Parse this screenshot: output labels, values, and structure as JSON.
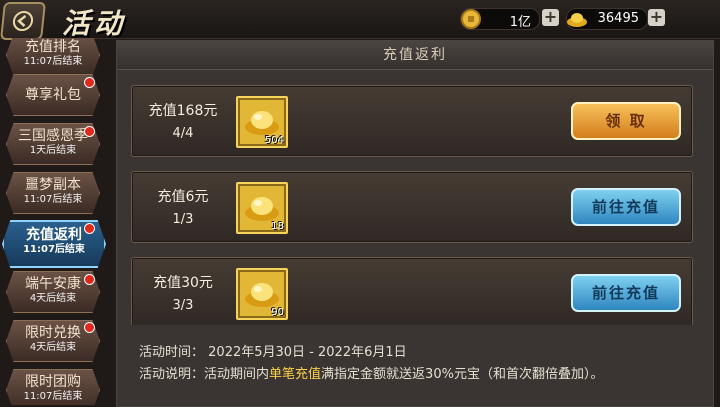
{
  "header": {
    "title": "活动"
  },
  "resources": {
    "copper": "1亿",
    "gold": "36495"
  },
  "sidebar": {
    "items": [
      {
        "name": "充值排名",
        "time": "11:07后结束",
        "dot": false
      },
      {
        "name": "尊享礼包",
        "time": "",
        "dot": true
      },
      {
        "name": "三国感恩季",
        "time": "1天后结束",
        "dot": true
      },
      {
        "name": "噩梦副本",
        "time": "11:07后结束",
        "dot": false
      },
      {
        "name": "充值返利",
        "time": "11:07后结束",
        "dot": true,
        "active": true
      },
      {
        "name": "端午安康",
        "time": "4天后结束",
        "dot": true
      },
      {
        "name": "限时兑换",
        "time": "4天后结束",
        "dot": true
      },
      {
        "name": "限时团购",
        "time": "11:07后结束",
        "dot": false
      }
    ]
  },
  "panel": {
    "title": "充值返利",
    "rows": [
      {
        "title": "充值168元",
        "progress": "4/4",
        "qty": "504",
        "button": "领 取",
        "button_type": "claim"
      },
      {
        "title": "充值6元",
        "progress": "1/3",
        "qty": "18",
        "button": "前往充值",
        "button_type": "go"
      },
      {
        "title": "充值30元",
        "progress": "3/3",
        "qty": "90",
        "button": "前往充值",
        "button_type": "go"
      }
    ],
    "info": {
      "time_label": "活动时间：",
      "time_value": "2022年5月30日 - 2022年6月1日",
      "desc_label": "活动说明：",
      "desc_pre": "活动期间内",
      "desc_highlight": "单笔充值",
      "desc_post": "满指定金额就送返30%元宝（和首次翻倍叠加）。"
    }
  },
  "colors": {
    "accent_gold": "#ffd24a",
    "claim_button": "#e39a2f",
    "go_button": "#4aa6d6",
    "active_tab": "#2a5f8e"
  },
  "icons": {
    "back": "back-arrow-icon",
    "copper": "copper-coin-icon",
    "gold": "gold-ingot-icon",
    "reward": "gold-ingot-icon"
  }
}
